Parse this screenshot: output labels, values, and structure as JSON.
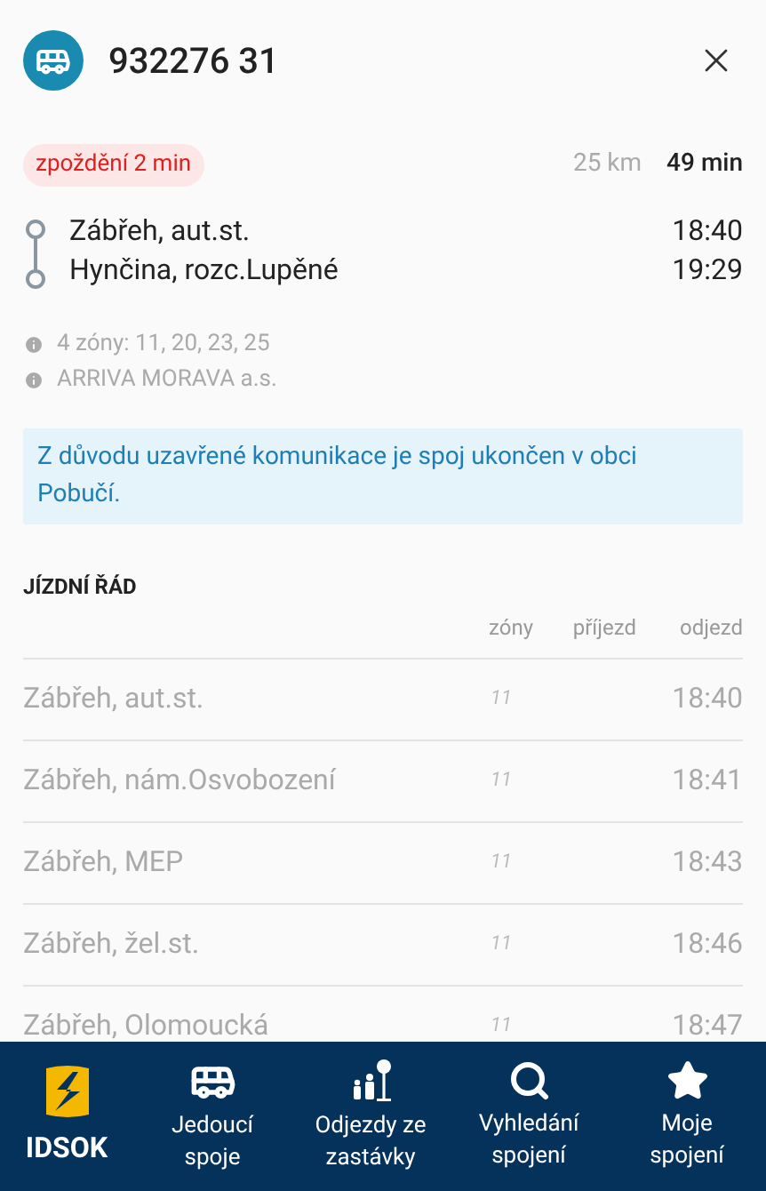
{
  "header": {
    "title": "932276 31"
  },
  "summary": {
    "delay": "zpoždění 2 min",
    "distance": "25 km",
    "duration": "49 min"
  },
  "route": [
    {
      "stop": "Zábřeh, aut.st.",
      "time": "18:40"
    },
    {
      "stop": "Hynčina, rozc.Lupěné",
      "time": "19:29"
    }
  ],
  "info": [
    "4 zóny: 11, 20, 23, 25",
    "ARRIVA MORAVA a.s."
  ],
  "notice": "Z důvodu uzavřené komunikace je spoj ukončen v obci Pobučí.",
  "timetable": {
    "title": "JÍZDNÍ ŘÁD",
    "columns": [
      "zóny",
      "příjezd",
      "odjezd"
    ],
    "rows": [
      {
        "stop": "Zábřeh, aut.st.",
        "zone": "11",
        "departure": "18:40"
      },
      {
        "stop": "Zábřeh, nám.Osvobození",
        "zone": "11",
        "departure": "18:41"
      },
      {
        "stop": "Zábřeh, MEP",
        "zone": "11",
        "departure": "18:43"
      },
      {
        "stop": "Zábřeh, žel.st.",
        "zone": "11",
        "departure": "18:46"
      },
      {
        "stop": "Zábřeh, Olomoucká",
        "zone": "11",
        "departure": "18:47"
      }
    ]
  },
  "nav": {
    "logo": "IDSOK",
    "items": [
      {
        "kind": "bus",
        "label": "Jedoucí spoje"
      },
      {
        "kind": "stop",
        "label": "Odjezdy ze zastávky"
      },
      {
        "kind": "search",
        "label": "Vyhledání spojení"
      },
      {
        "kind": "star",
        "label": "Moje spojení"
      }
    ]
  }
}
